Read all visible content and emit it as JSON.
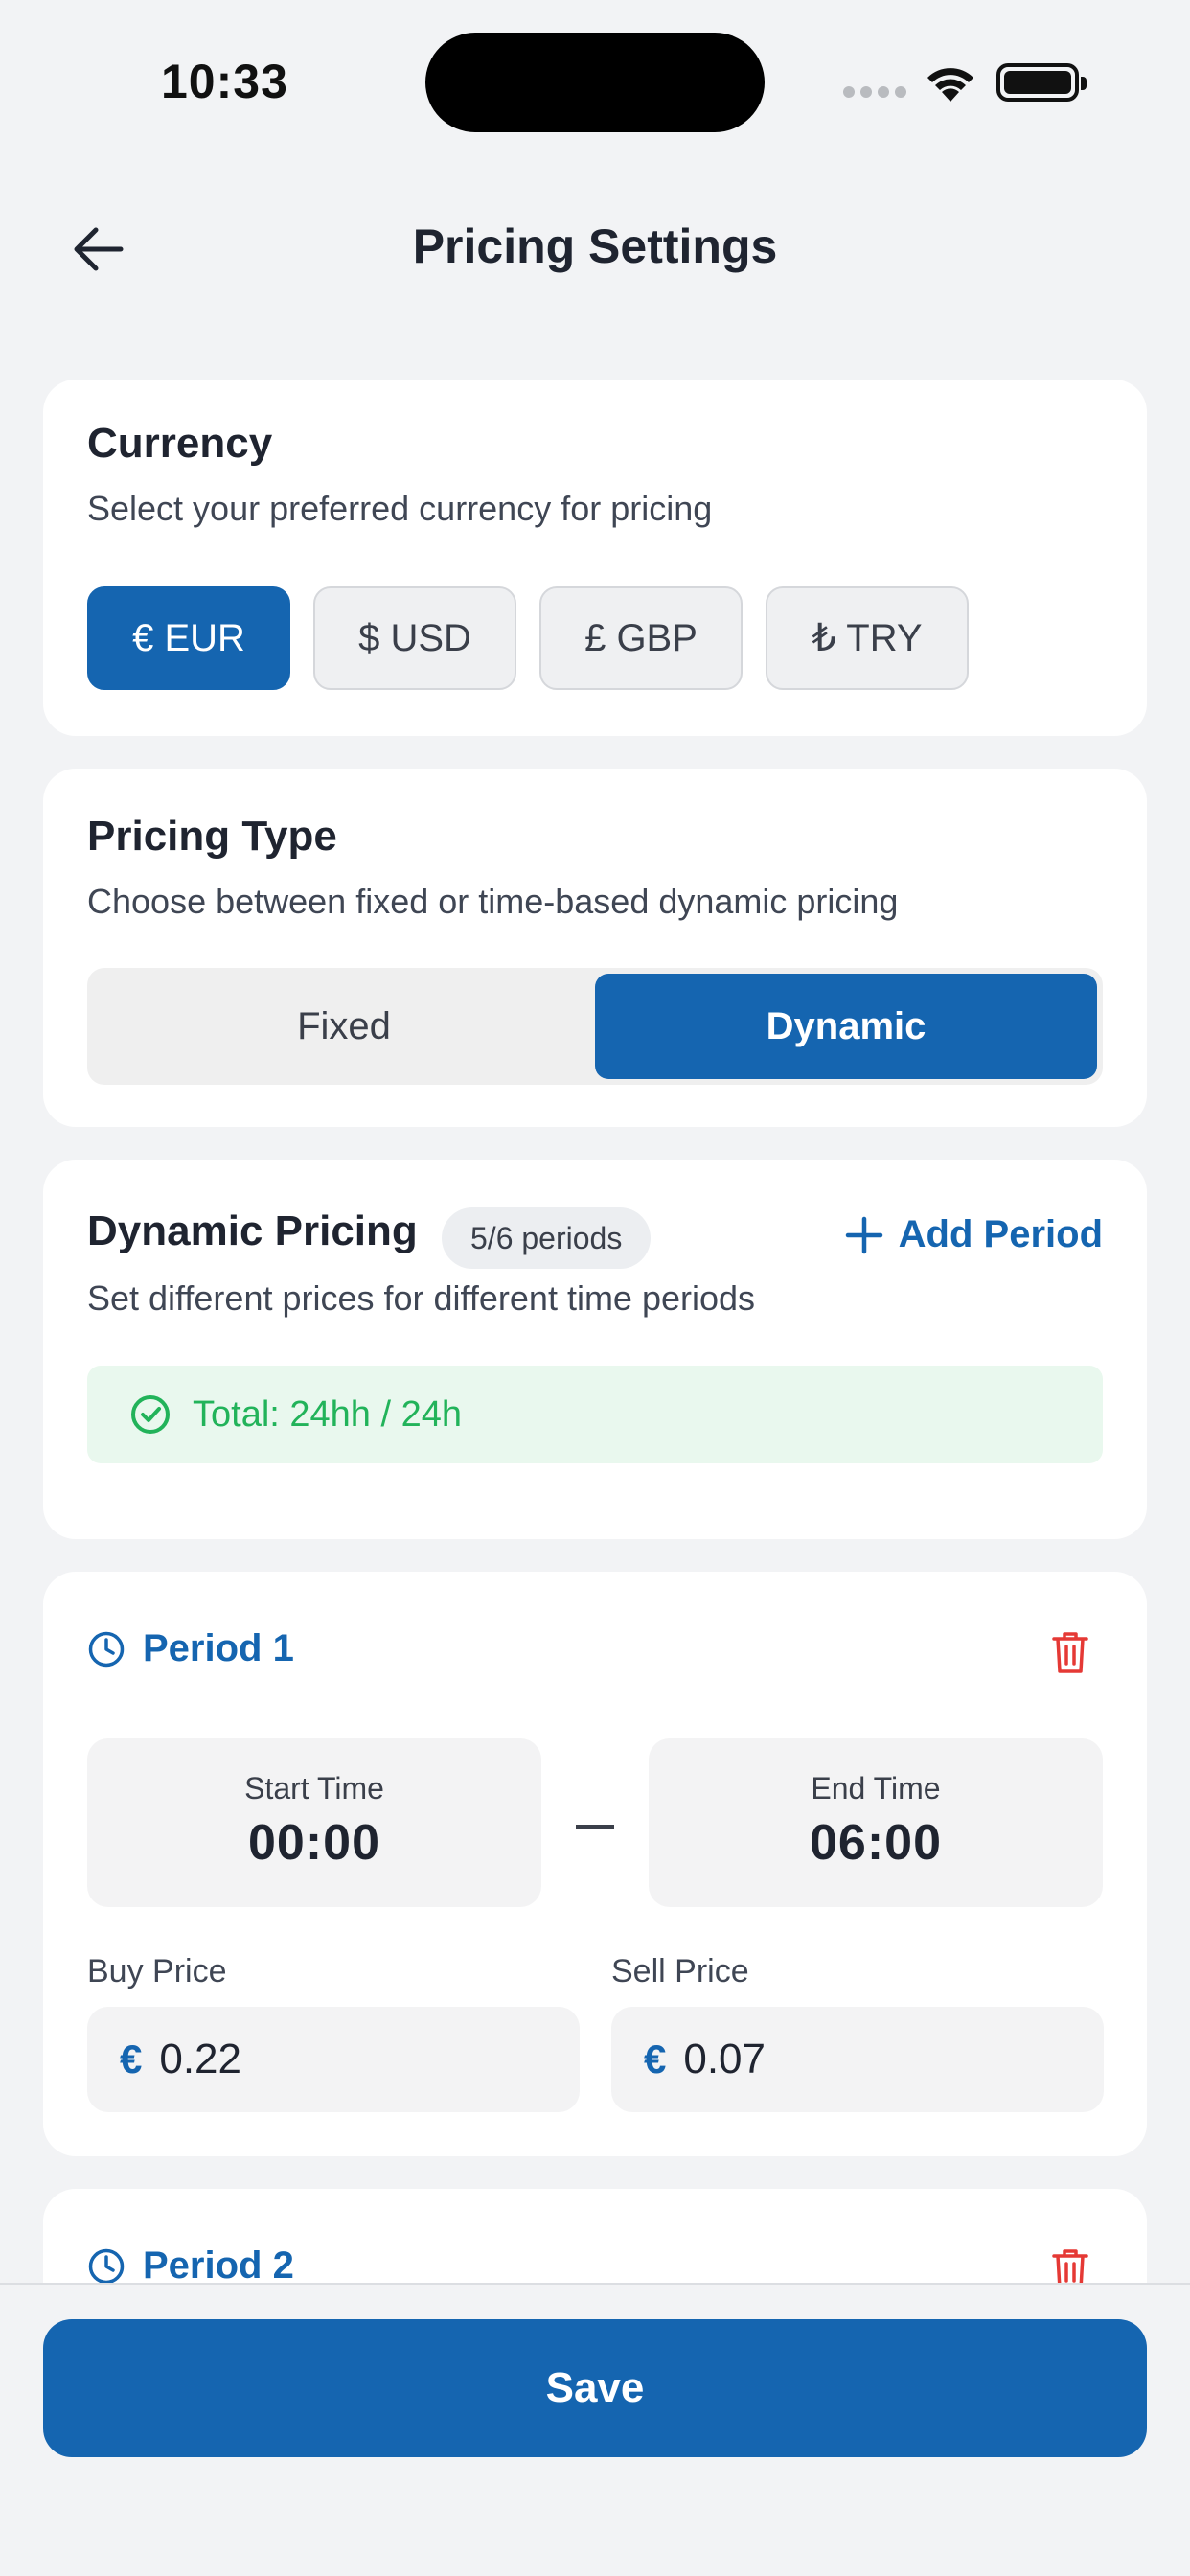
{
  "status_bar": {
    "time": "10:33"
  },
  "header": {
    "title": "Pricing Settings",
    "back_icon": "arrow-left-icon"
  },
  "currency": {
    "title": "Currency",
    "subtitle": "Select your preferred currency for pricing",
    "options": [
      {
        "label": "€ EUR",
        "selected": true
      },
      {
        "label": "$ USD",
        "selected": false
      },
      {
        "label": "£ GBP",
        "selected": false
      },
      {
        "label": "₺ TRY",
        "selected": false
      }
    ]
  },
  "pricing_type": {
    "title": "Pricing Type",
    "subtitle": "Choose between fixed or time-based dynamic pricing",
    "options": [
      {
        "label": "Fixed",
        "selected": false
      },
      {
        "label": "Dynamic",
        "selected": true
      }
    ]
  },
  "dynamic_pricing": {
    "title": "Dynamic Pricing",
    "badge": "5/6 periods",
    "add_label": "Add Period",
    "subtitle": "Set different prices for different time periods",
    "total": "Total: 24hh / 24h"
  },
  "periods": [
    {
      "title": "Period 1",
      "start_label": "Start Time",
      "start_value": "00:00",
      "end_label": "End Time",
      "end_value": "06:00",
      "buy_label": "Buy Price",
      "buy_symbol": "€",
      "buy_value": "0.22",
      "sell_label": "Sell Price",
      "sell_symbol": "€",
      "sell_value": "0.07"
    },
    {
      "title": "Period 2"
    }
  ],
  "footer": {
    "save_label": "Save"
  },
  "colors": {
    "accent": "#1565b0",
    "success": "#22b35a",
    "danger": "#e53935",
    "background": "#f2f3f5"
  }
}
